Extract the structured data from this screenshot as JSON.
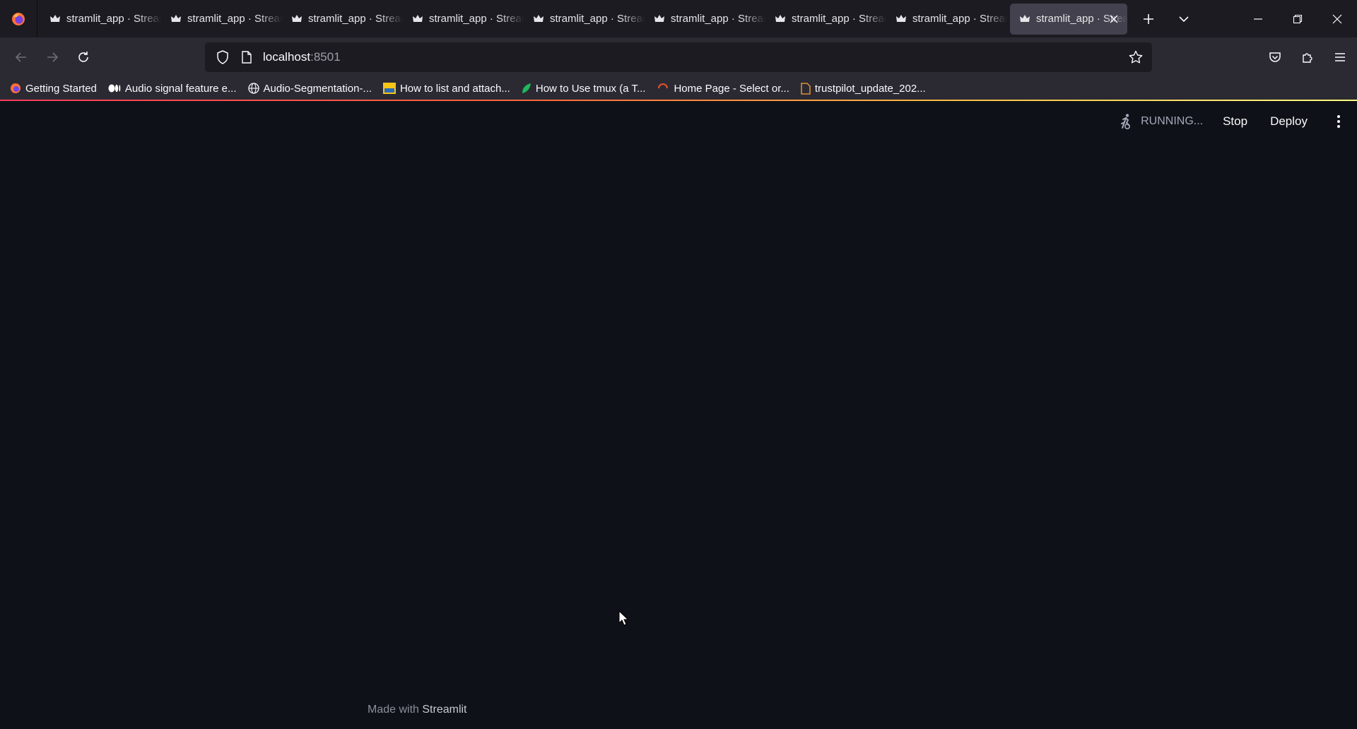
{
  "browser": {
    "tabs": [
      {
        "label": "stramlit_app · Streamlit",
        "active": false
      },
      {
        "label": "stramlit_app · Streamlit",
        "active": false
      },
      {
        "label": "stramlit_app · Streamlit",
        "active": false
      },
      {
        "label": "stramlit_app · Streamlit",
        "active": false
      },
      {
        "label": "stramlit_app · Streamlit",
        "active": false
      },
      {
        "label": "stramlit_app · Streamlit",
        "active": false
      },
      {
        "label": "stramlit_app · Streamlit",
        "active": false
      },
      {
        "label": "stramlit_app · Streamlit",
        "active": false
      },
      {
        "label": "stramlit_app · Streamlit",
        "active": true
      }
    ],
    "url": {
      "host": "localhost",
      "port": ":8501"
    },
    "bookmarks": [
      {
        "label": "Getting Started",
        "icon": "firefox-icon"
      },
      {
        "label": "Audio signal feature e...",
        "icon": "medium-icon"
      },
      {
        "label": "Audio-Segmentation-...",
        "icon": "globe-icon"
      },
      {
        "label": "How to list and attach...",
        "icon": "linux-site-icon"
      },
      {
        "label": "How to Use tmux (a T...",
        "icon": "leaf-icon"
      },
      {
        "label": "Home Page - Select or...",
        "icon": "spinner-icon"
      },
      {
        "label": "trustpilot_update_202...",
        "icon": "file-icon"
      }
    ]
  },
  "app": {
    "status": "RUNNING...",
    "stop_label": "Stop",
    "deploy_label": "Deploy",
    "footer_prefix": "Made with",
    "footer_brand": "Streamlit"
  },
  "colors": {
    "background": "#0e1117",
    "tabbar": "#1c1b22",
    "toolbar": "#2b2a33"
  }
}
